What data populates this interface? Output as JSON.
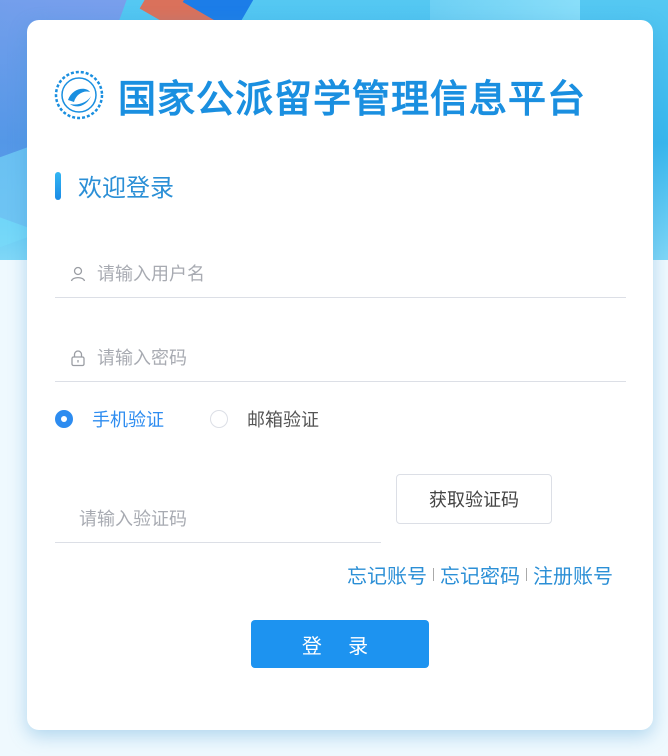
{
  "header": {
    "title": "国家公派留学管理信息平台",
    "logo_icon": "csc-logo-icon"
  },
  "welcome": {
    "text": "欢迎登录"
  },
  "form": {
    "username": {
      "placeholder": "请输入用户名",
      "value": "",
      "icon": "user-icon"
    },
    "password": {
      "placeholder": "请输入密码",
      "value": "",
      "icon": "lock-icon"
    },
    "verify_methods": [
      {
        "label": "手机验证",
        "selected": true
      },
      {
        "label": "邮箱验证",
        "selected": false
      }
    ],
    "code": {
      "placeholder": "请输入验证码",
      "value": ""
    },
    "get_code_label": "获取验证码",
    "links": [
      "忘记账号",
      "忘记密码",
      "注册账号"
    ],
    "login_label": "登 录"
  },
  "colors": {
    "accent": "#1d93f0",
    "title": "#1a8fe0"
  }
}
